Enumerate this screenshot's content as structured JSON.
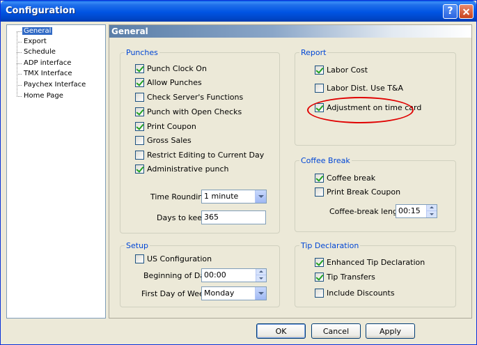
{
  "window": {
    "title": "Configuration",
    "help_label": "?"
  },
  "tree": {
    "items": [
      {
        "label": "General",
        "selected": true
      },
      {
        "label": "Export"
      },
      {
        "label": "Schedule"
      },
      {
        "label": "ADP interface"
      },
      {
        "label": "TMX Interface"
      },
      {
        "label": "Paychex Interface"
      },
      {
        "label": "Home Page"
      }
    ]
  },
  "panel": {
    "title": "General"
  },
  "punches": {
    "title": "Punches",
    "items": [
      {
        "label": "Punch Clock On",
        "checked": true
      },
      {
        "label": "Allow Punches",
        "checked": true
      },
      {
        "label": "Check Server's Functions",
        "checked": false
      },
      {
        "label": "Punch with Open Checks",
        "checked": true
      },
      {
        "label": "Print Coupon",
        "checked": true
      },
      {
        "label": "Gross Sales",
        "checked": false
      },
      {
        "label": "Restrict Editing to Current Day",
        "checked": false
      },
      {
        "label": "Administrative punch",
        "checked": true
      }
    ],
    "time_rounding_label": "Time Rounding",
    "time_rounding_value": "1 minute",
    "days_to_keep_label": "Days to keep",
    "days_to_keep_value": "365"
  },
  "report": {
    "title": "Report",
    "items": [
      {
        "label": "Labor Cost",
        "checked": true
      },
      {
        "label": "Labor Dist. Use T&A",
        "checked": false
      },
      {
        "label": "Adjustment on time card",
        "checked": true
      }
    ]
  },
  "coffee": {
    "title": "Coffee Break",
    "items": [
      {
        "label": "Coffee break",
        "checked": true
      },
      {
        "label": "Print Break Coupon",
        "checked": false
      }
    ],
    "length_label": "Coffee-break length",
    "length_value": "00:15"
  },
  "setup": {
    "title": "Setup",
    "us_config_label": "US Configuration",
    "us_config_checked": false,
    "beginning_label": "Beginning of Day",
    "beginning_value": "00:00",
    "first_day_label": "First Day of Week",
    "first_day_value": "Monday"
  },
  "tip": {
    "title": "Tip Declaration",
    "items": [
      {
        "label": "Enhanced Tip Declaration",
        "checked": true
      },
      {
        "label": "Tip Transfers",
        "checked": true
      },
      {
        "label": "Include Discounts",
        "checked": false
      }
    ]
  },
  "buttons": {
    "ok": "OK",
    "cancel": "Cancel",
    "apply": "Apply"
  },
  "colors": {
    "titlebar": "#0054e3",
    "group_label": "#0046d5",
    "annotation": "#e00000",
    "selection": "#316ac5"
  }
}
